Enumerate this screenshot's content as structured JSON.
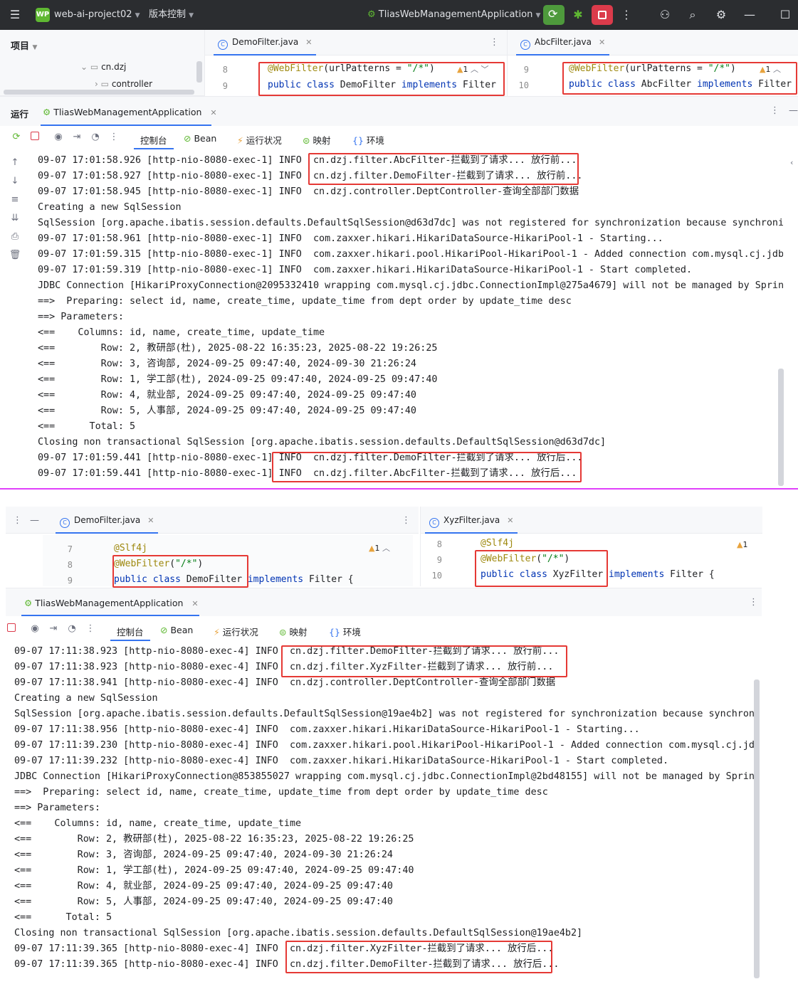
{
  "top": {
    "logo": "WP",
    "project": "web-ai-project02",
    "vcs": "版本控制",
    "run_config": "TliasWebManagementApplication"
  },
  "s1": {
    "project_label": "项目",
    "tree": [
      {
        "label": "cn.dzj"
      },
      {
        "label": "controller"
      }
    ],
    "left_tab": "DemoFilter.java",
    "right_tab": "AbcFilter.java",
    "left_lines": [
      "8",
      "9"
    ],
    "right_lines": [
      "9",
      "10"
    ],
    "left_code": {
      "annotation": "@WebFilter",
      "args_open": "(urlPatterns = ",
      "args_str": "\"/*\"",
      "args_close": ")",
      "kw": "public class",
      "rest": " DemoFilter ",
      "impl": "implements",
      "iface": " Filter"
    },
    "right_code": {
      "annotation": "@WebFilter",
      "args_open": "(urlPatterns = ",
      "args_str": "\"/*\"",
      "args_close": ")",
      "kw": "public class",
      "rest": " AbcFilter ",
      "impl": "implements",
      "iface": " Filter"
    },
    "warn_left": "1",
    "warn_right": "1",
    "run_label": "运行",
    "run_tab": "TliasWebManagementApplication",
    "toolbar": {
      "console": "控制台",
      "bean": "Bean",
      "health": "运行状况",
      "mappings": "映射",
      "env": "环境"
    },
    "console": [
      "09-07 17:01:58.926 [http-nio-8080-exec-1] INFO  cn.dzj.filter.AbcFilter-拦截到了请求... 放行前...",
      "09-07 17:01:58.927 [http-nio-8080-exec-1] INFO  cn.dzj.filter.DemoFilter-拦截到了请求... 放行前...",
      "09-07 17:01:58.945 [http-nio-8080-exec-1] INFO  cn.dzj.controller.DeptController-查询全部部门数据",
      "Creating a new SqlSession",
      "SqlSession [org.apache.ibatis.session.defaults.DefaultSqlSession@d63d7dc] was not registered for synchronization because synchroniz",
      "09-07 17:01:58.961 [http-nio-8080-exec-1] INFO  com.zaxxer.hikari.HikariDataSource-HikariPool-1 - Starting...",
      "09-07 17:01:59.315 [http-nio-8080-exec-1] INFO  com.zaxxer.hikari.pool.HikariPool-HikariPool-1 - Added connection com.mysql.cj.jdbc",
      "09-07 17:01:59.319 [http-nio-8080-exec-1] INFO  com.zaxxer.hikari.HikariDataSource-HikariPool-1 - Start completed.",
      "JDBC Connection [HikariProxyConnection@2095332410 wrapping com.mysql.cj.jdbc.ConnectionImpl@275a4679] will not be managed by Spring",
      "==>  Preparing: select id, name, create_time, update_time from dept order by update_time desc",
      "==> Parameters: ",
      "<==    Columns: id, name, create_time, update_time",
      "<==        Row: 2, 教研部(杜), 2025-08-22 16:35:23, 2025-08-22 19:26:25",
      "<==        Row: 3, 咨询部, 2024-09-25 09:47:40, 2024-09-30 21:26:24",
      "<==        Row: 1, 学工部(杜), 2024-09-25 09:47:40, 2024-09-25 09:47:40",
      "<==        Row: 4, 就业部, 2024-09-25 09:47:40, 2024-09-25 09:47:40",
      "<==        Row: 5, 人事部, 2024-09-25 09:47:40, 2024-09-25 09:47:40",
      "<==      Total: 5",
      "Closing non transactional SqlSession [org.apache.ibatis.session.defaults.DefaultSqlSession@d63d7dc]",
      "09-07 17:01:59.441 [http-nio-8080-exec-1] INFO  cn.dzj.filter.DemoFilter-拦截到了请求... 放行后...",
      "09-07 17:01:59.441 [http-nio-8080-exec-1] INFO  cn.dzj.filter.AbcFilter-拦截到了请求... 放行后..."
    ]
  },
  "s2": {
    "left_tab": "DemoFilter.java",
    "right_tab": "XyzFilter.java",
    "left_lines": [
      "7",
      "8",
      "9"
    ],
    "right_lines": [
      "8",
      "9",
      "10"
    ],
    "left_code": {
      "slf": "@Slf4j",
      "annotation": "@WebFilter",
      "args_open": "(",
      "args_str": "\"/*\"",
      "args_close": ")",
      "kw": "public class",
      "rest": " DemoFilter ",
      "impl": "implements",
      "iface": " Filter {"
    },
    "right_code": {
      "slf": "@Slf4j",
      "annotation": "@WebFilter",
      "args_open": "(",
      "args_str": "\"/*\"",
      "args_close": ")",
      "kw": "public class",
      "rest": " XyzFilter ",
      "impl": "implements",
      "iface": " Filter {"
    },
    "warn_left": "1",
    "warn_right": "1",
    "run_tab": "TliasWebManagementApplication",
    "toolbar": {
      "console": "控制台",
      "bean": "Bean",
      "health": "运行状况",
      "mappings": "映射",
      "env": "环境"
    },
    "console": [
      "09-07 17:11:38.923 [http-nio-8080-exec-4] INFO  cn.dzj.filter.DemoFilter-拦截到了请求... 放行前...",
      "09-07 17:11:38.923 [http-nio-8080-exec-4] INFO  cn.dzj.filter.XyzFilter-拦截到了请求... 放行前...",
      "09-07 17:11:38.941 [http-nio-8080-exec-4] INFO  cn.dzj.controller.DeptController-查询全部部门数据",
      "Creating a new SqlSession",
      "SqlSession [org.apache.ibatis.session.defaults.DefaultSqlSession@19ae4b2] was not registered for synchronization because synchroniz",
      "09-07 17:11:38.956 [http-nio-8080-exec-4] INFO  com.zaxxer.hikari.HikariDataSource-HikariPool-1 - Starting...",
      "09-07 17:11:39.230 [http-nio-8080-exec-4] INFO  com.zaxxer.hikari.pool.HikariPool-HikariPool-1 - Added connection com.mysql.cj.jdbc",
      "09-07 17:11:39.232 [http-nio-8080-exec-4] INFO  com.zaxxer.hikari.HikariDataSource-HikariPool-1 - Start completed.",
      "JDBC Connection [HikariProxyConnection@853855027 wrapping com.mysql.cj.jdbc.ConnectionImpl@2bd48155] will not be managed by Spring",
      "==>  Preparing: select id, name, create_time, update_time from dept order by update_time desc",
      "==> Parameters: ",
      "<==    Columns: id, name, create_time, update_time",
      "<==        Row: 2, 教研部(杜), 2025-08-22 16:35:23, 2025-08-22 19:26:25",
      "<==        Row: 3, 咨询部, 2024-09-25 09:47:40, 2024-09-30 21:26:24",
      "<==        Row: 1, 学工部(杜), 2024-09-25 09:47:40, 2024-09-25 09:47:40",
      "<==        Row: 4, 就业部, 2024-09-25 09:47:40, 2024-09-25 09:47:40",
      "<==        Row: 5, 人事部, 2024-09-25 09:47:40, 2024-09-25 09:47:40",
      "<==      Total: 5",
      "Closing non transactional SqlSession [org.apache.ibatis.session.defaults.DefaultSqlSession@19ae4b2]",
      "09-07 17:11:39.365 [http-nio-8080-exec-4] INFO  cn.dzj.filter.XyzFilter-拦截到了请求... 放行后...",
      "09-07 17:11:39.365 [http-nio-8080-exec-4] INFO  cn.dzj.filter.DemoFilter-拦截到了请求... 放行后..."
    ]
  }
}
